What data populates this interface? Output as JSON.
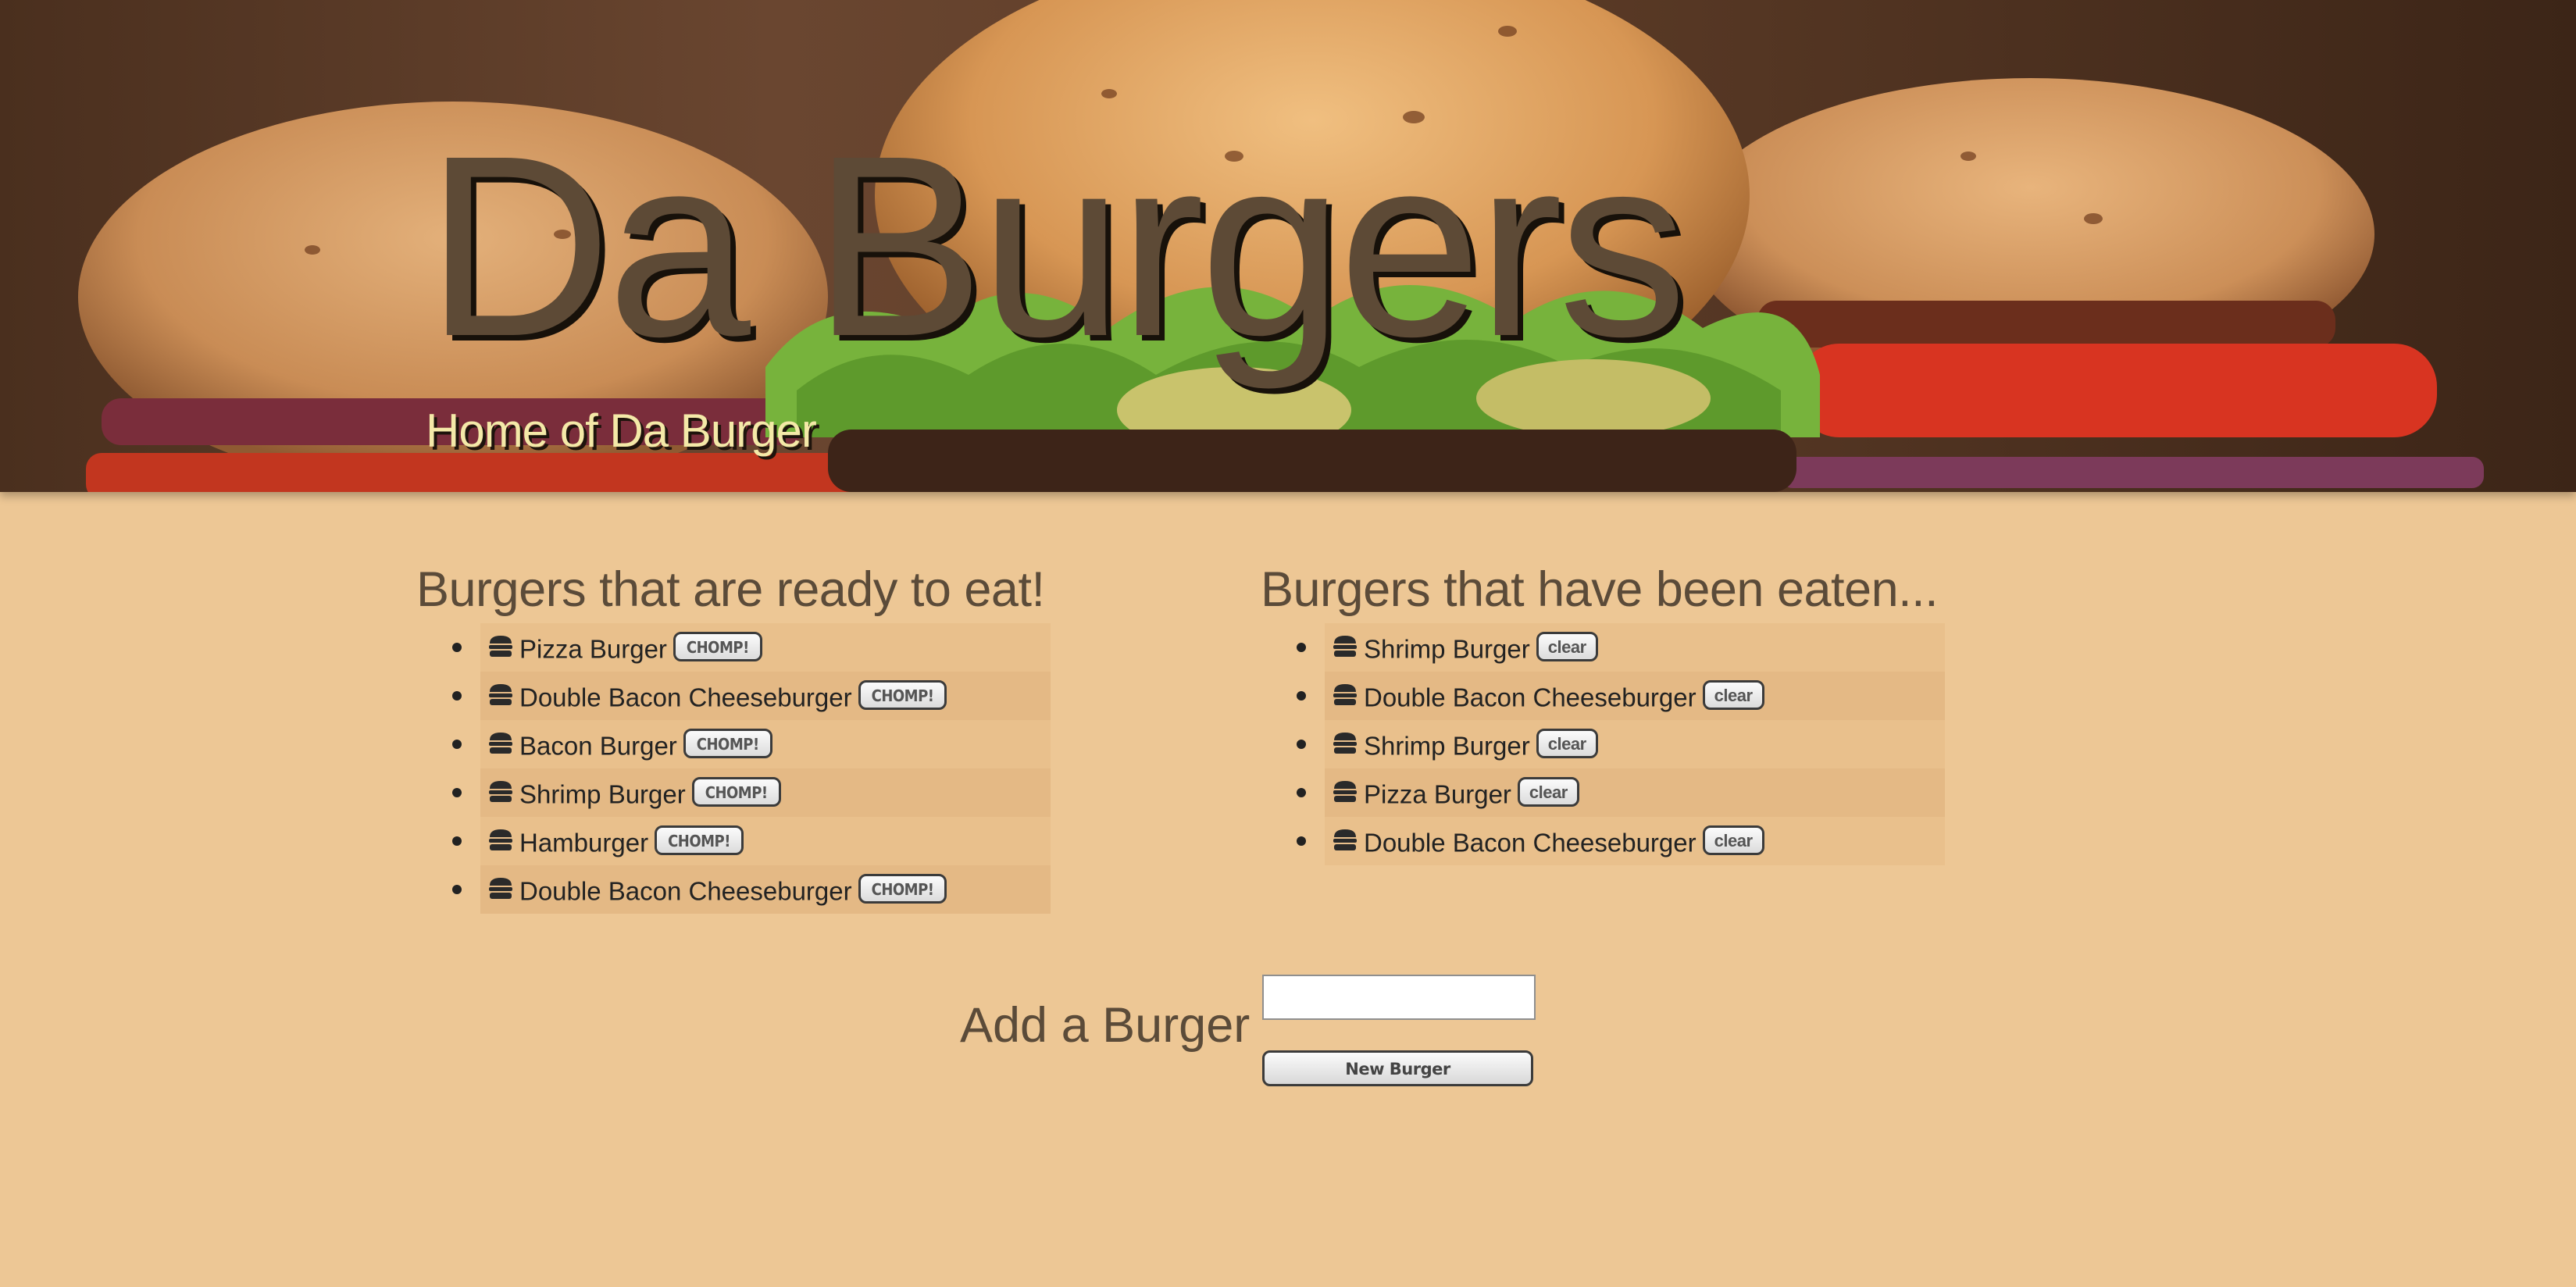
{
  "header": {
    "title": "Da Burgers",
    "subtitle": "Home of Da Burger"
  },
  "ready": {
    "heading": "Burgers that are ready to eat!",
    "button_label": "CHOMP!",
    "items": [
      "Pizza Burger",
      "Double Bacon Cheeseburger",
      "Bacon Burger",
      "Shrimp Burger",
      "Hamburger",
      "Double Bacon Cheeseburger"
    ]
  },
  "eaten": {
    "heading": "Burgers that have been eaten...",
    "button_label": "clear",
    "items": [
      "Shrimp Burger",
      "Double Bacon Cheeseburger",
      "Shrimp Burger",
      "Pizza Burger",
      "Double Bacon Cheeseburger"
    ]
  },
  "add_form": {
    "heading": "Add a Burger",
    "input_value": "",
    "input_placeholder": "",
    "submit_label": "New Burger"
  },
  "icons": {
    "list_item_icon": "hamburger-icon"
  },
  "colors": {
    "page_background": "#edc795",
    "heading_text": "#5b4b39",
    "subtitle_text": "#f4e9a8",
    "row_odd": "#e9c08c",
    "row_even": "#e4b985"
  }
}
